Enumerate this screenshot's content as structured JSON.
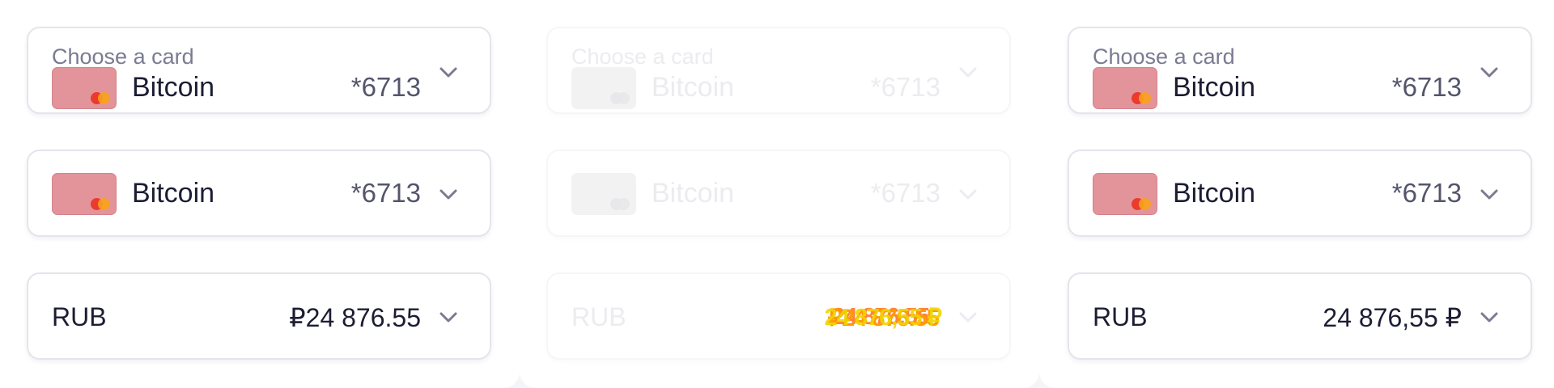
{
  "panels": {
    "left": {
      "card_select": {
        "label": "Choose a card",
        "card_name": "Bitcoin",
        "card_number": "*6713"
      },
      "card_select_compact": {
        "card_name": "Bitcoin",
        "card_number": "*6713"
      },
      "currency_select": {
        "code": "RUB",
        "amount": "₽24 876.55"
      }
    },
    "middle": {
      "card_select": {
        "label": "Choose a card",
        "card_name": "Bitcoin",
        "card_number": "*6713"
      },
      "card_select_compact": {
        "card_name": "Bitcoin",
        "card_number": "*6713"
      },
      "currency_select": {
        "code": "RUB",
        "amount_overlap_1": "24 876,55 ₽",
        "amount_overlap_2": "₽24 876.55",
        "amount_overlap_3": "24 876.55"
      }
    },
    "right": {
      "card_select": {
        "label": "Choose a card",
        "card_name": "Bitcoin",
        "card_number": "*6713"
      },
      "card_select_compact": {
        "card_name": "Bitcoin",
        "card_number": "*6713"
      },
      "currency_select": {
        "code": "RUB",
        "amount": "24 876,55 ₽"
      }
    }
  },
  "colors": {
    "page_bg": "#f4f5f9",
    "card_bg": "#e2949a",
    "mastercard_red": "#eb3b2f",
    "mastercard_orange": "#f9a21b",
    "text_primary": "#1c1d33",
    "text_secondary": "#7a7b92"
  },
  "icons": {
    "card_brand": "mastercard-icon",
    "dropdown": "chevron-down-icon"
  }
}
